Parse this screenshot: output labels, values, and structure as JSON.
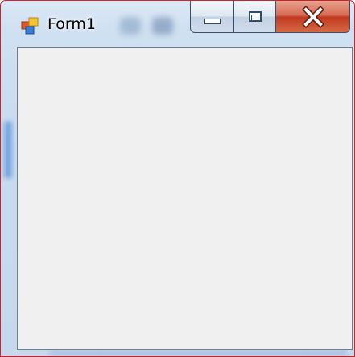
{
  "window": {
    "title": "Form1",
    "icon": "winforms-app-icon",
    "caption_buttons": [
      "minimize-icon",
      "maximize-icon",
      "close-icon"
    ]
  },
  "colors": {
    "frame_border": "#c8262b",
    "client_background": "#f0f0f0",
    "close_button": "#c2391f"
  }
}
